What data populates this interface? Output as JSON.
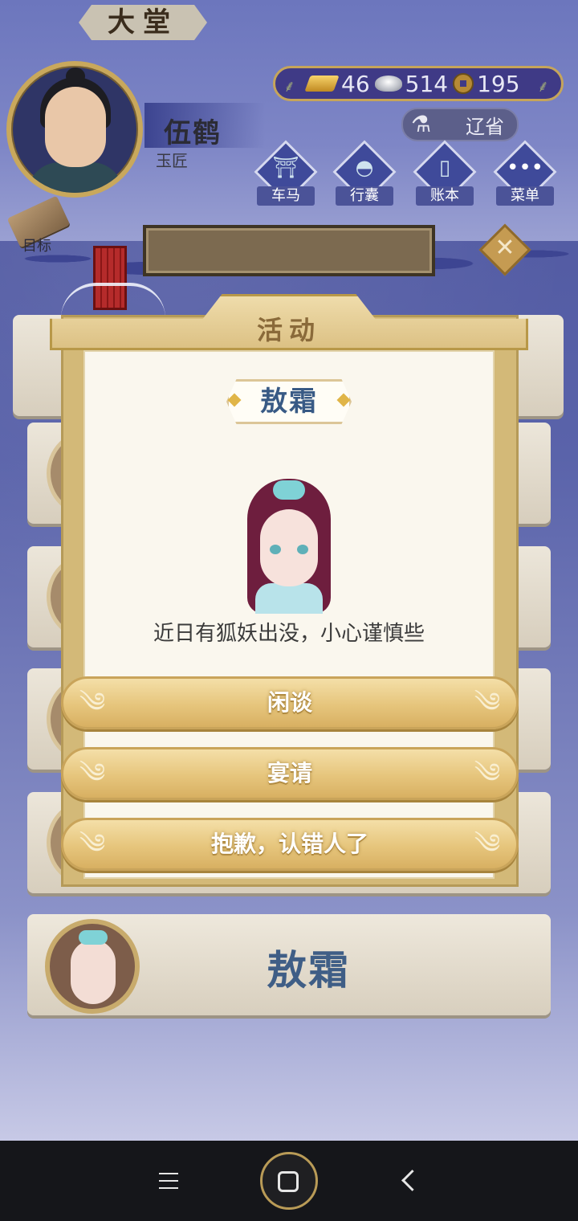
{
  "player": {
    "name": "伍鹤",
    "title": "玉匠"
  },
  "currencies": {
    "gold": "46",
    "silver": "514",
    "coins": "195"
  },
  "province": "辽省",
  "menu": [
    {
      "label": "车马",
      "icon": "carriage-icon"
    },
    {
      "label": "行囊",
      "icon": "bag-icon"
    },
    {
      "label": "账本",
      "icon": "ledger-icon"
    },
    {
      "label": "菜单",
      "icon": "more-icon"
    }
  ],
  "goal_label": "目标",
  "hall_title": "大堂",
  "dialog": {
    "title": "活动",
    "npc_name": "敖霜",
    "line": "近日有狐妖出没，小心谨慎些",
    "options": [
      "闲谈",
      "宴请",
      "抱歉，认错人了"
    ]
  },
  "bottom_item_name": "敖霜",
  "colors": {
    "accent_gold": "#d3b978",
    "npc_name_blue": "#385a85",
    "background_blue": "#5a64a8"
  }
}
